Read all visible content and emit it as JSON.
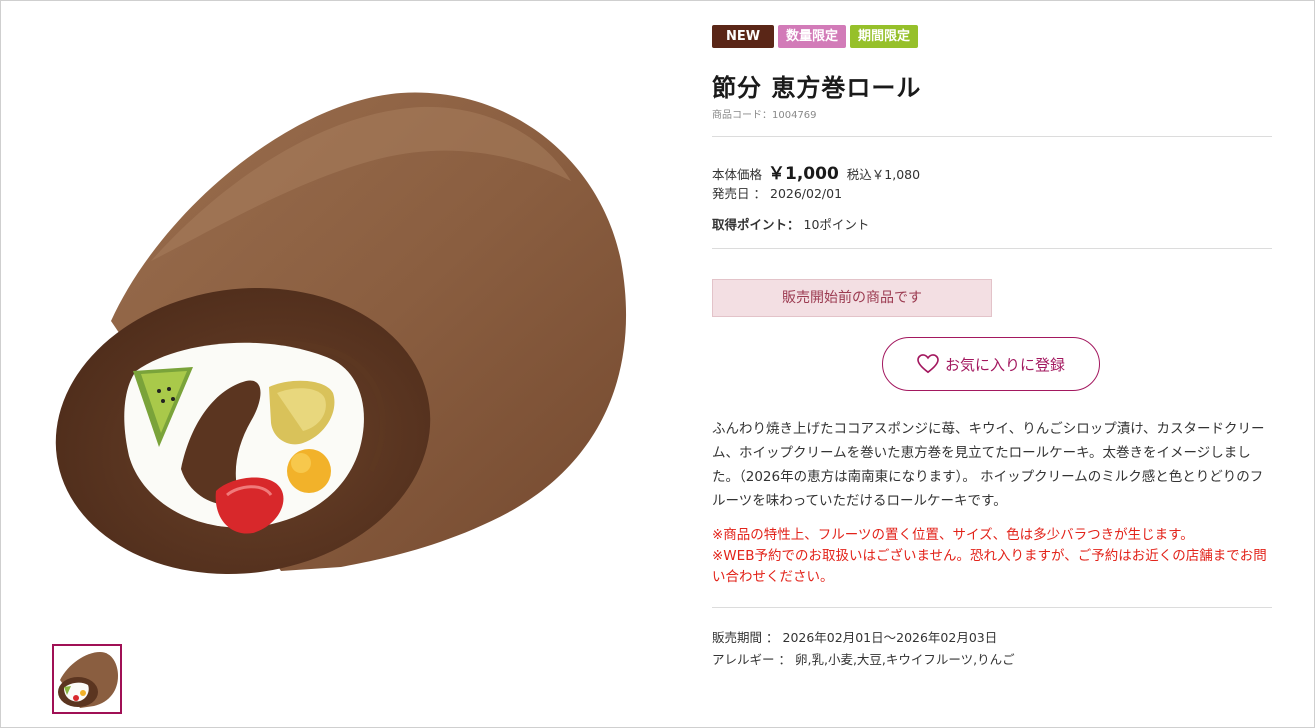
{
  "badges": {
    "new": "NEW",
    "limited_qty": "数量限定",
    "limited_period": "期間限定"
  },
  "product": {
    "title": "節分 恵方巻ロール",
    "code": "商品コード：1004769"
  },
  "price": {
    "base_label": "本体価格",
    "base_value": "￥1,000",
    "tax_value": "税込￥1,080"
  },
  "release": {
    "label": "発売日",
    "sep": "：",
    "value": "2026/02/01"
  },
  "points": {
    "label": "取得ポイント：",
    "value": "10ポイント"
  },
  "status": {
    "text": "販売開始前の商品です"
  },
  "favorite": {
    "label": "お気に入りに登録",
    "icon": "heart-icon"
  },
  "description": "ふんわり焼き上げたココアスポンジに苺、キウイ、りんごシロップ漬け、カスタードクリーム、ホイップクリームを巻いた恵方巻を見立てたロールケーキ。太巻きをイメージしました。（2026年の恵方は南南東になります）。 ホイップクリームのミルク感と色とりどりのフルーツを味わっていただけるロールケーキです。",
  "warnings": {
    "line1": "※商品の特性上、フルーツの置く位置、サイズ、色は多少バラつきが生じます。",
    "line2": "※WEB予約でのお取扱いはございません。恐れ入りますが、ご予約はお近くの店舗までお問い合わせください。"
  },
  "details": {
    "period_label": "販売期間",
    "period_sep": "：",
    "period_value": "2026年02月01日～2026年02月03日",
    "allergy_label": "アレルギー",
    "allergy_sep": "：",
    "allergy_value": "卵,乳,小麦,大豆,キウイフルーツ,りんご"
  },
  "colors": {
    "accent": "#a3185f",
    "warning": "#e2231a",
    "badge_new": "#5a2617",
    "badge_limit": "#d27bb8",
    "badge_period": "#96c02a",
    "notice_bg": "#f3dfe3"
  }
}
